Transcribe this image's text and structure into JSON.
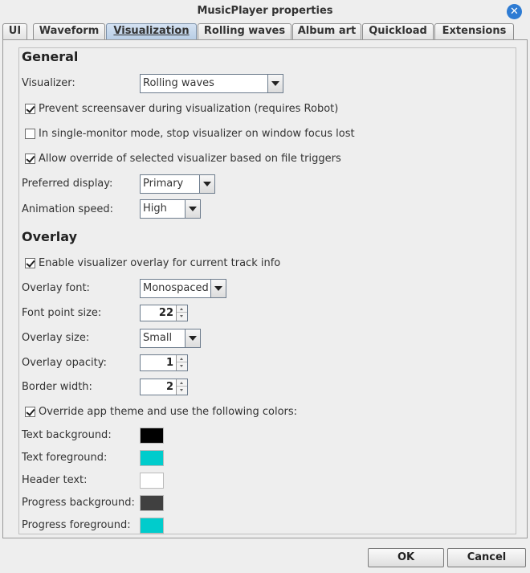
{
  "window": {
    "title": "MusicPlayer properties",
    "close_icon": "close-icon"
  },
  "tabs": [
    {
      "label": "UI"
    },
    {
      "label": "Waveform"
    },
    {
      "label": "Visualization"
    },
    {
      "label": "Rolling waves"
    },
    {
      "label": "Album art"
    },
    {
      "label": "Quickload"
    },
    {
      "label": "Extensions"
    }
  ],
  "active_tab": "Visualization",
  "general": {
    "title": "General",
    "visualizer_label": "Visualizer:",
    "visualizer_value": "Rolling waves",
    "prevent_screensaver_label": "Prevent screensaver during visualization (requires Robot)",
    "prevent_screensaver_checked": true,
    "single_monitor_label": "In single-monitor mode, stop visualizer on window focus lost",
    "single_monitor_checked": false,
    "allow_override_label": "Allow override of selected visualizer based on file triggers",
    "allow_override_checked": true,
    "preferred_display_label": "Preferred display:",
    "preferred_display_value": "Primary",
    "animation_speed_label": "Animation speed:",
    "animation_speed_value": "High"
  },
  "overlay": {
    "title": "Overlay",
    "enable_overlay_label": "Enable visualizer overlay for current track info",
    "enable_overlay_checked": true,
    "font_label": "Overlay font:",
    "font_value": "Monospaced",
    "point_size_label": "Font point size:",
    "point_size_value": "22",
    "size_label": "Overlay size:",
    "size_value": "Small",
    "opacity_label": "Overlay opacity:",
    "opacity_value": "1",
    "border_width_label": "Border width:",
    "border_width_value": "2",
    "override_theme_label": "Override app theme and use the following colors:",
    "override_theme_checked": true,
    "colors": {
      "text_background_label": "Text background:",
      "text_background_color": "#000000",
      "text_foreground_label": "Text foreground:",
      "text_foreground_color": "#00cccc",
      "header_text_label": "Header text:",
      "header_text_color": "#ffffff",
      "progress_background_label": "Progress background:",
      "progress_background_color": "#404040",
      "progress_foreground_label": "Progress foreground:",
      "progress_foreground_color": "#00cccc"
    }
  },
  "buttons": {
    "ok_label": "OK",
    "cancel_label": "Cancel"
  }
}
